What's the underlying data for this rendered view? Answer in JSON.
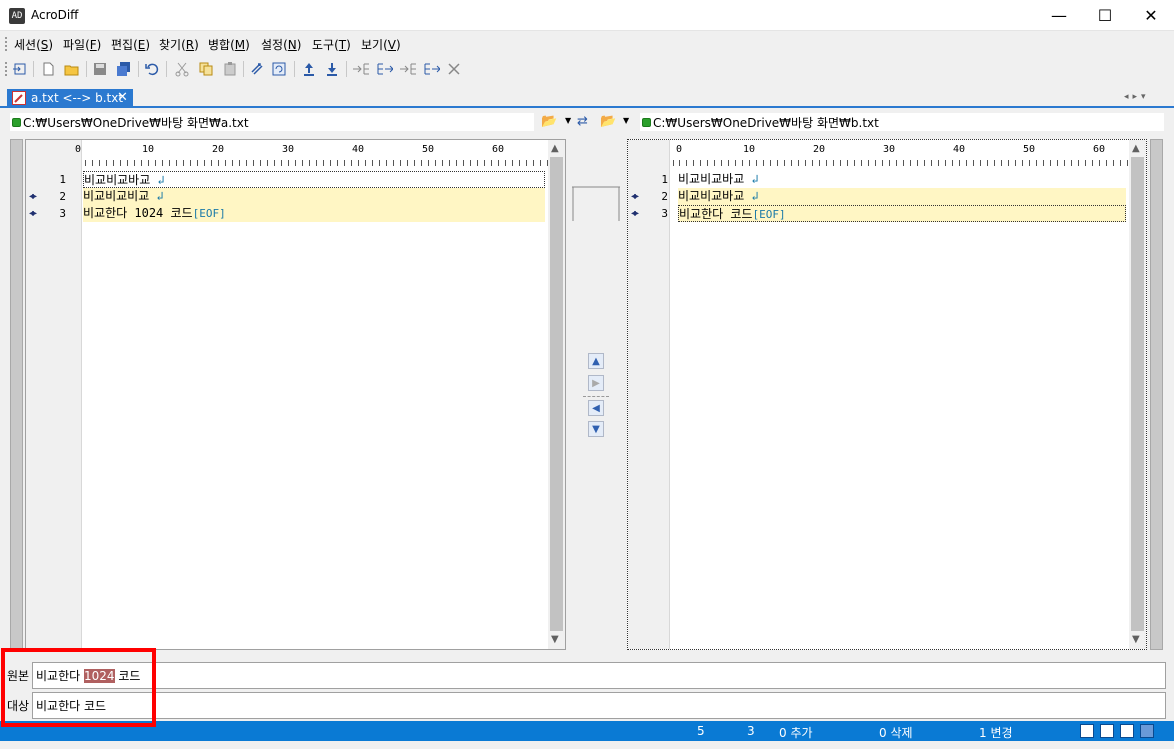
{
  "window": {
    "title": "AcroDiff",
    "icon": "app-logo-icon"
  },
  "menu": [
    {
      "label": "세션(",
      "key": "S",
      "end": ")"
    },
    {
      "label": "파일(",
      "key": "F",
      "end": ")"
    },
    {
      "label": "편집(",
      "key": "E",
      "end": ")"
    },
    {
      "label": "찾기(",
      "key": "R",
      "end": ")"
    },
    {
      "label": "병합(",
      "key": "M",
      "end": ")"
    },
    {
      "label": "설정(",
      "key": "N",
      "end": ")"
    },
    {
      "label": "도구(",
      "key": "T",
      "end": ")"
    },
    {
      "label": "보기(",
      "key": "V",
      "end": ")"
    }
  ],
  "tab": {
    "label": "a.txt <--> b.txt"
  },
  "left": {
    "path": "C:₩Users₩OneDrive₩바탕 화면₩a.txt",
    "lines": [
      {
        "num": "1",
        "text": "비교비교바교",
        "end": "↲"
      },
      {
        "num": "2",
        "text": "비교비교비교",
        "end": "↲"
      },
      {
        "num": "3",
        "text": "비교한다 1024 코드",
        "end": "[EOF]"
      }
    ]
  },
  "right": {
    "path": "C:₩Users₩OneDrive₩바탕 화면₩b.txt",
    "lines": [
      {
        "num": "1",
        "text": "비교비교바교",
        "end": "↲"
      },
      {
        "num": "2",
        "text": "비교비교바교",
        "end": "↲"
      },
      {
        "num": "3",
        "text": "비교한다 코드",
        "end": "[EOF]"
      }
    ]
  },
  "ruler": {
    "marks": [
      "0",
      "10",
      "20",
      "30",
      "40",
      "50",
      "60"
    ]
  },
  "compare": {
    "source_label": "원본",
    "source_before": "비교한다 ",
    "source_diff": "1024",
    "source_after": " 코드",
    "target_label": "대상",
    "target_text": "비교한다 코드"
  },
  "status": {
    "line": "5",
    "col": "3",
    "added": "0 추가",
    "deleted": "0 삭제",
    "changed": "1 변경"
  },
  "colors": {
    "accent": "#0a7ad4",
    "changed_line": "#fff6c4",
    "highlight": "#ff0000"
  }
}
